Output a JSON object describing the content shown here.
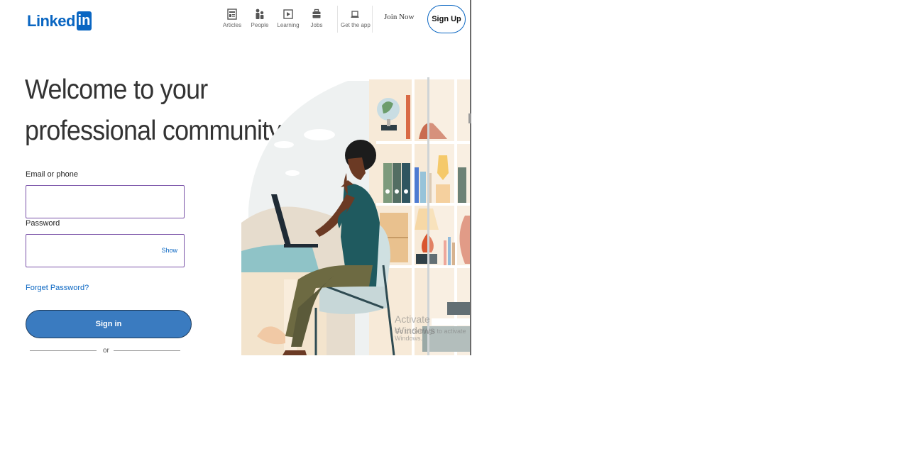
{
  "header": {
    "logo_text": "Linked",
    "logo_box": "in",
    "nav": [
      {
        "label": "Articles",
        "icon": "articles-icon"
      },
      {
        "label": "People",
        "icon": "people-icon"
      },
      {
        "label": "Learning",
        "icon": "learning-icon"
      },
      {
        "label": "Jobs",
        "icon": "jobs-icon"
      },
      {
        "label": "Get the app",
        "icon": "laptop-icon"
      }
    ],
    "join_now": "Join Now",
    "sign_up": "Sign Up"
  },
  "main": {
    "headline_line1": "Welcome to your",
    "headline_line2": "professional community",
    "email_label": "Email or phone",
    "email_value": "",
    "password_label": "Password",
    "password_value": "",
    "show_label": "Show",
    "forgot": "Forget Password?",
    "signin": "Sign in",
    "or": "or"
  },
  "overlay": {
    "activate_title": "Activate Windows",
    "activate_sub": "Go to Settings to activate Windows."
  },
  "colors": {
    "brand": "#0a66c2",
    "signin_bg": "#3a7bc0",
    "input_border": "#7a52a8"
  }
}
